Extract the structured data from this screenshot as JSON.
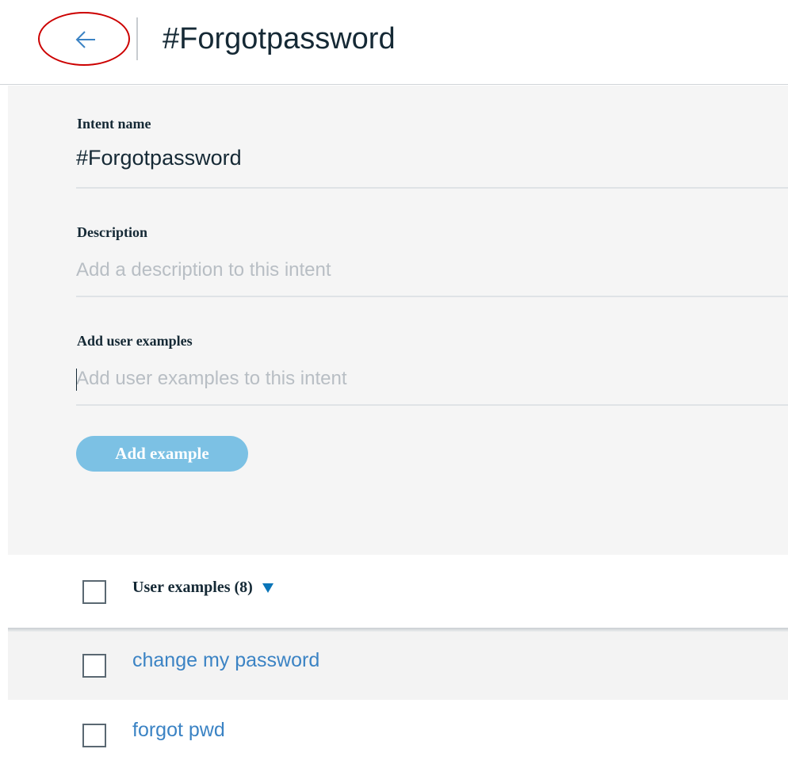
{
  "header": {
    "back_icon": "arrow-left-icon",
    "title": "#Forgotpassword"
  },
  "form": {
    "intent_name": {
      "label": "Intent name",
      "value": "#Forgotpassword"
    },
    "description": {
      "label": "Description",
      "placeholder": "Add a description to this intent"
    },
    "user_examples_input": {
      "label": "Add user examples",
      "placeholder": "Add user examples to this intent"
    },
    "add_example_label": "Add example"
  },
  "examples": {
    "header_label": "User examples (8)",
    "sort_icon": "caret-down-icon",
    "items": [
      {
        "text": "change my password"
      },
      {
        "text": "forgot pwd"
      }
    ]
  },
  "colors": {
    "accent": "#3b83c4",
    "button": "#7cc1e4",
    "annotation": "#cc0000"
  }
}
